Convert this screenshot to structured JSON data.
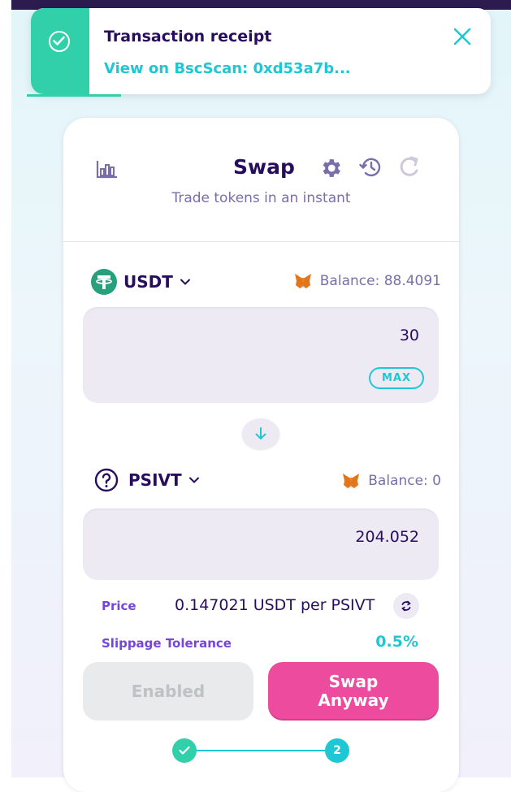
{
  "toast": {
    "title": "Transaction receipt",
    "link_text": "View on BscScan: 0xd53a7b..."
  },
  "card": {
    "title": "Swap",
    "subtitle": "Trade tokens in an instant"
  },
  "from": {
    "token": "USDT",
    "balance": "Balance: 88.4091",
    "amount": "30",
    "max_label": "MAX"
  },
  "to": {
    "token": "PSIVT",
    "balance": "Balance: 0",
    "amount": "204.052"
  },
  "info": {
    "price_label": "Price",
    "price_value": "0.147021 USDT per PSIVT",
    "slippage_label": "Slippage Tolerance",
    "slippage_value": "0.5%"
  },
  "buttons": {
    "enabled_label": "Enabled",
    "swap_line1": "Swap",
    "swap_line2": "Anyway"
  },
  "stepper": {
    "step2_label": "2"
  },
  "colors": {
    "primary_text": "#280d5f",
    "secondary_text": "#7a6eaa",
    "accent_teal": "#1fc7d4",
    "success_green": "#31d0aa",
    "swap_pink": "#ed4b9e",
    "label_purple": "#7645d9"
  },
  "icons": [
    "check-circle-icon",
    "close-icon",
    "chart-icon",
    "gear-icon",
    "history-icon",
    "refresh-icon",
    "tether-icon",
    "chevron-down-icon",
    "metamask-fox-icon",
    "arrow-down-icon",
    "unknown-token-icon",
    "swap-direction-icon",
    "check-icon"
  ]
}
